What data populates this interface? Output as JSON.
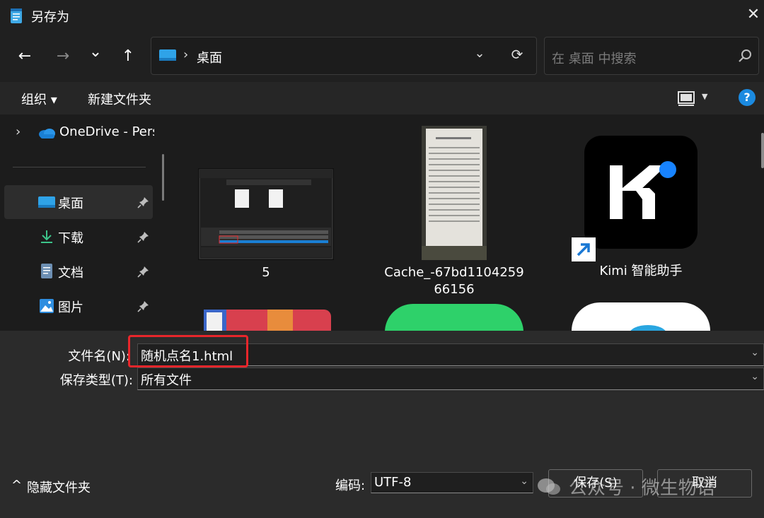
{
  "window": {
    "title": "另存为",
    "close_glyph": "✕"
  },
  "nav": {
    "back_glyph": "←",
    "forward_glyph": "→",
    "recent_glyph": "⌄",
    "up_glyph": "↑",
    "address_separator": "›",
    "address_path": "桌面",
    "address_dropdown_glyph": "⌄",
    "refresh_glyph": "⟳",
    "search_placeholder": "在 桌面 中搜索"
  },
  "toolbar": {
    "organize_label": "组织 ▾",
    "new_folder_label": "新建文件夹",
    "view_dropdown_glyph": "▼",
    "help_glyph": "?"
  },
  "sidebar": {
    "expand_glyph": "›",
    "onedrive_label": "OneDrive - Personal",
    "items": [
      {
        "label": "桌面",
        "icon": "desktop-folder-icon",
        "selected": true
      },
      {
        "label": "下载",
        "icon": "download-icon"
      },
      {
        "label": "文档",
        "icon": "documents-icon"
      },
      {
        "label": "图片",
        "icon": "pictures-icon"
      }
    ]
  },
  "files": [
    {
      "name": "5",
      "type": "screenshot-thumbnail"
    },
    {
      "name": "Cache_-67bd110425966156",
      "name_line1": "Cache_-67bd1104259",
      "name_line2": "66156",
      "type": "document-photo-thumbnail"
    },
    {
      "name": "Kimi 智能助手",
      "type": "app-shortcut",
      "icon": "kimi-logo-icon"
    }
  ],
  "bottom": {
    "filename_label": "文件名(N):",
    "filename_value": "随机点名1.html",
    "filetype_label": "保存类型(T):",
    "filetype_value": "所有文件",
    "hide_folders_label": "隐藏文件夹",
    "hide_folders_glyph": "^",
    "encoding_label": "编码:",
    "encoding_value": "UTF-8",
    "save_label": "保存(S)",
    "cancel_label": "取消",
    "dropdown_glyph": "⌄"
  },
  "watermark": {
    "text": "公众号 · 微生物语"
  },
  "colors": {
    "accent": "#1b8ae0",
    "highlight_box": "#e8262b",
    "background": "#202020"
  }
}
